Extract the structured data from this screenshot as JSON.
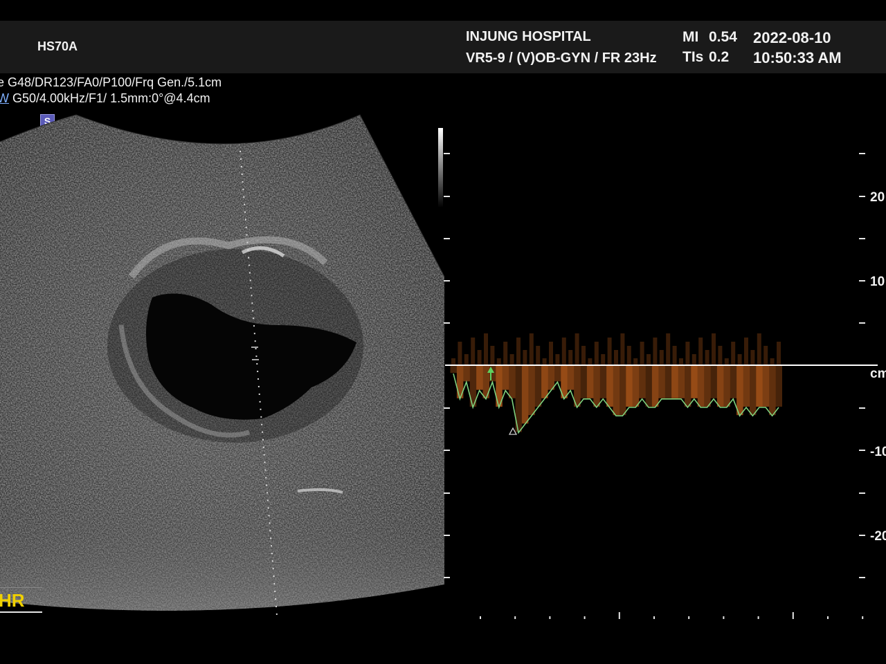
{
  "header": {
    "model": "HS70A",
    "hospital": "INJUNG HOSPITAL",
    "probe_preset": "VR5-9 / (V)OB-GYN / FR 23Hz",
    "mi_label": "MI",
    "mi_value": "0.54",
    "tis_label": "TIs",
    "tis_value": "0.2",
    "date": "2022-08-10",
    "time": "10:50:33 AM"
  },
  "params": {
    "line1": "e G48/DR123/FA0/P100/Frq Gen./5.1cm",
    "line2_prefix": "W",
    "line2": " G50/4.00kHz/F1/ 1.5mm:0°@4.4cm"
  },
  "badge": {
    "label": "S"
  },
  "hr": {
    "label": "HR"
  },
  "doppler": {
    "scale_labels": [
      "20",
      "10",
      "cm",
      "-10",
      "-20"
    ],
    "baseline_unit": "cm",
    "colors": {
      "trace": "#7fd27f",
      "spectrum": "#c8641e",
      "baseline": "#ffffff"
    }
  },
  "chart_data": {
    "type": "line",
    "title": "",
    "xlabel": "",
    "ylabel": "cm/s",
    "ylim": [
      -25,
      25
    ],
    "series": [
      {
        "name": "",
        "x": [
          0,
          1,
          2,
          3,
          4,
          5,
          6,
          7,
          8,
          9,
          10,
          11,
          12,
          13,
          14,
          15,
          16,
          17,
          18,
          19,
          20,
          21,
          22,
          23,
          24,
          25,
          26,
          27,
          28,
          29,
          30,
          31,
          32,
          33,
          34,
          35,
          36,
          37,
          38,
          39,
          40,
          41,
          42,
          43,
          44,
          45,
          46,
          47,
          48,
          49,
          50
        ],
        "values": [
          -1,
          -4,
          -2,
          -5,
          -3,
          -4,
          -2,
          -5,
          -3,
          -4,
          -8,
          -7,
          -6,
          -5,
          -4,
          -3,
          -2,
          -4,
          -3,
          -5,
          -4,
          -4,
          -5,
          -4,
          -5,
          -6,
          -6,
          -5,
          -5,
          -4,
          -5,
          -5,
          -4,
          -4,
          -4,
          -4,
          -5,
          -4,
          -5,
          -5,
          -4,
          -5,
          -5,
          -4,
          -6,
          -5,
          -6,
          -5,
          -5,
          -6,
          -5
        ]
      }
    ]
  }
}
